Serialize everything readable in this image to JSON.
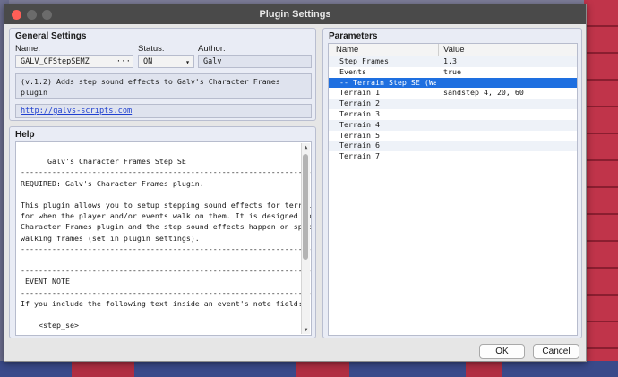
{
  "window": {
    "title": "Plugin Settings"
  },
  "general": {
    "title": "General Settings",
    "name_label": "Name:",
    "name_value": "GALV_CFStepSEMZ",
    "name_button": "···",
    "status_label": "Status:",
    "status_value": "ON",
    "author_label": "Author:",
    "author_value": "Galv",
    "description": "(v.1.2) Adds step sound effects to Galv's Character Frames plugin",
    "link": "http://galvs-scripts.com"
  },
  "help": {
    "title": "Help",
    "text": "Galv's Character Frames Step SE\n--------------------------------------------------------------------------\nREQUIRED: Galv's Character Frames plugin.\n\nThis plugin allows you to setup stepping sound effects for terrain tags\nfor when the player and/or events walk on them. It is designed to use my\nCharacter Frames plugin and the step sound effects happen on specified\nwalking frames (set in plugin settings).\n--------------------------------------------------------------------------\n\n--------------------------------------------------------------------------\n EVENT NOTE\n--------------------------------------------------------------------------\nIf you include the following text inside an event's note field:\n\n    <step_se>\n\nThen the event will play step sound effects when walking on terrains which"
  },
  "parameters": {
    "title": "Parameters",
    "col_name": "Name",
    "col_value": "Value",
    "rows": [
      {
        "name": "Step Frames",
        "value": "1,3"
      },
      {
        "name": "Events",
        "value": "true"
      },
      {
        "name": "-- Terrain Step SE (Walk...",
        "value": ""
      },
      {
        "name": "Terrain 1",
        "value": "sandstep 4, 20, 60"
      },
      {
        "name": "Terrain 2",
        "value": ""
      },
      {
        "name": "Terrain 3",
        "value": ""
      },
      {
        "name": "Terrain 4",
        "value": ""
      },
      {
        "name": "Terrain 5",
        "value": ""
      },
      {
        "name": "Terrain 6",
        "value": ""
      },
      {
        "name": "Terrain 7",
        "value": ""
      }
    ],
    "selected_index": 2
  },
  "buttons": {
    "ok": "OK",
    "cancel": "Cancel"
  },
  "colors": {
    "selection": "#1e6fe0",
    "titlebar": "#4a4a4a",
    "map_red": "#c0344a"
  }
}
